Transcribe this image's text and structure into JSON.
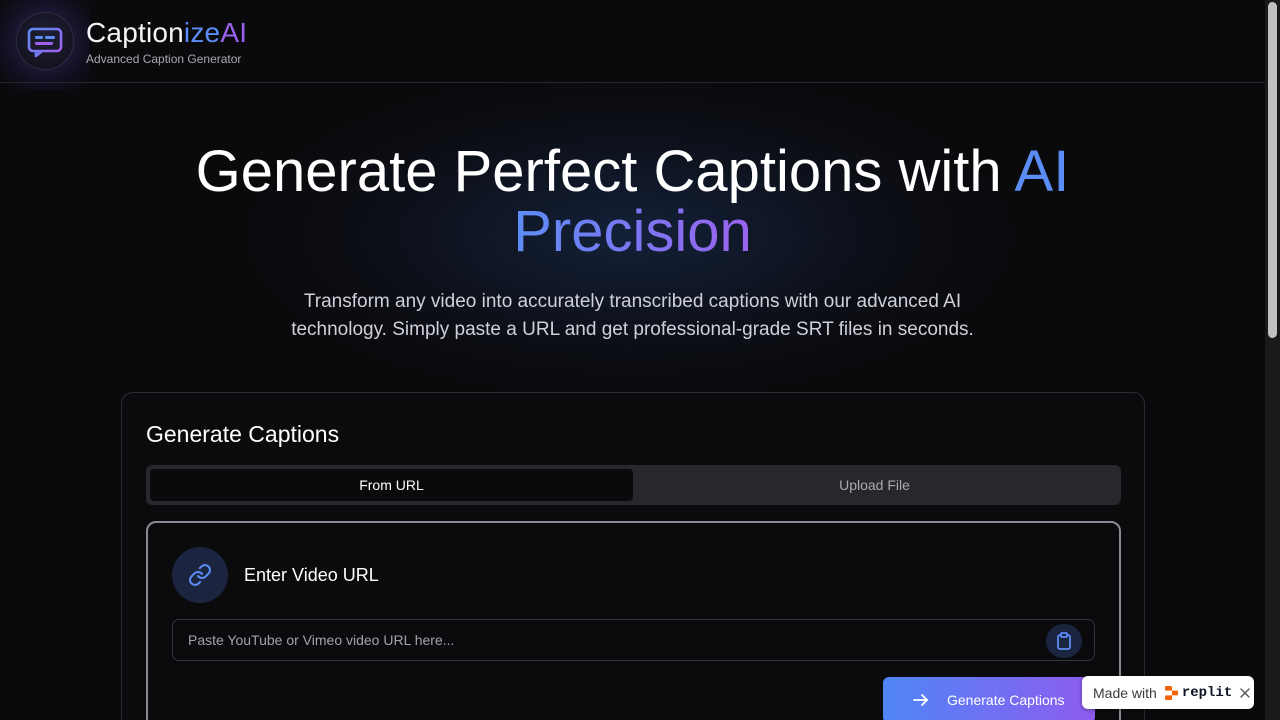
{
  "header": {
    "brand_part1": "Caption",
    "brand_part2": "ize",
    "brand_part3": "AI",
    "tagline": "Advanced Caption Generator"
  },
  "hero": {
    "title_main": "Generate Perfect Captions with ",
    "title_ai": "AI",
    "title_precision": "Precision",
    "subtitle": "Transform any video into accurately transcribed captions with our advanced AI technology. Simply paste a URL and get professional-grade SRT files in seconds."
  },
  "card": {
    "title": "Generate Captions",
    "tabs": [
      {
        "label": "From URL",
        "active": true
      },
      {
        "label": "Upload File",
        "active": false
      }
    ],
    "url_panel": {
      "title": "Enter Video URL",
      "input_value": "",
      "input_placeholder": "Paste YouTube or Vimeo video URL here...",
      "generate_label": "Generate Captions"
    }
  },
  "badge": {
    "made_with": "Made with",
    "brand": "replit"
  },
  "colors": {
    "background": "#0a0a0c",
    "accent_blue": "#5b8df6",
    "accent_purple": "#9b62ee",
    "icon_circle": "#1b2540"
  },
  "icons": [
    "captions-logo-icon",
    "link-icon",
    "clipboard-icon",
    "arrow-right-icon",
    "replit-logo-icon",
    "close-icon"
  ]
}
